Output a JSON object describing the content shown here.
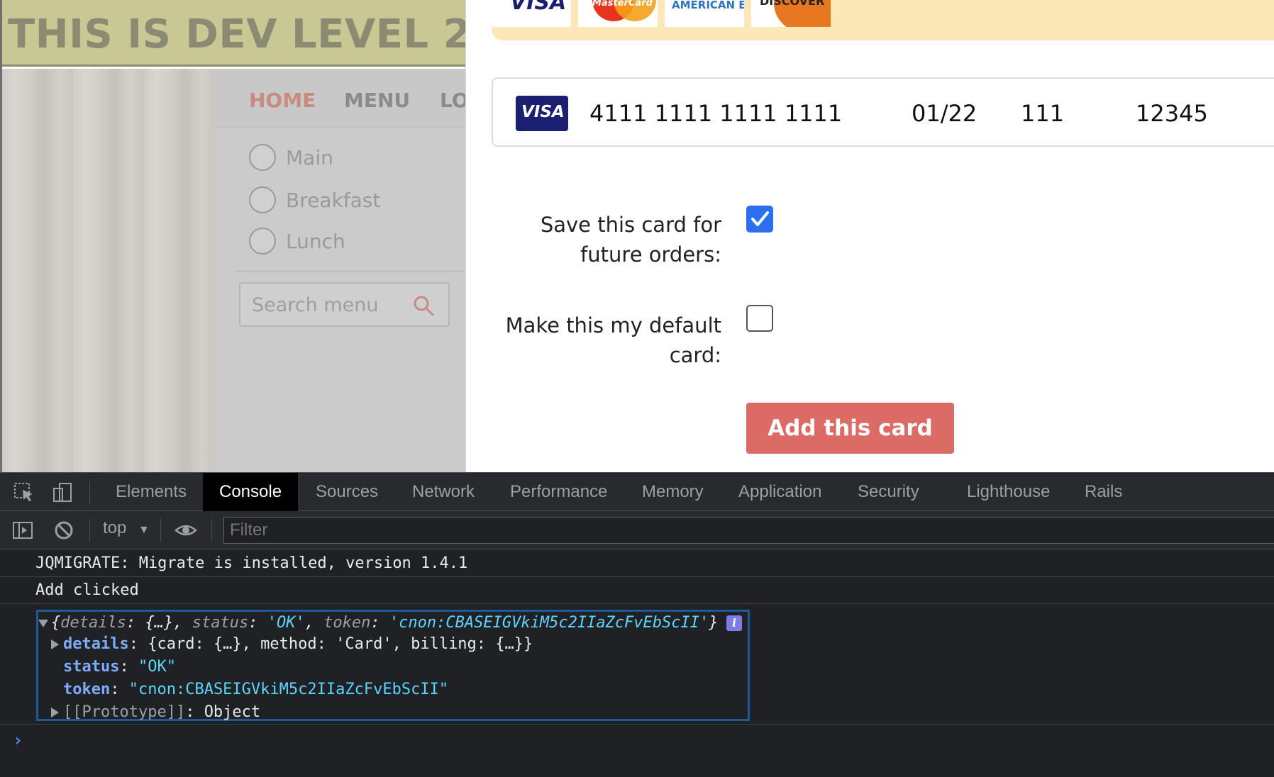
{
  "site": {
    "dev_banner": "THIS IS DEV LEVEL 2",
    "nav": [
      "HOME",
      "MENU",
      "LO"
    ],
    "menu_filters": [
      "Main",
      "Breakfast",
      "Lunch"
    ],
    "search_placeholder": "Search menu",
    "accent_color": "#c98a80"
  },
  "payment": {
    "accepted_cards": {
      "visa": "VISA",
      "mastercard": "MasterCard",
      "amex": "AMERICAN EXPRESS",
      "discover": "DISCOVER"
    },
    "card": {
      "brand": "VISA",
      "number": "4111 1111 1111 1111",
      "expiry": "01/22",
      "cvv": "111",
      "postal": "12345"
    },
    "save_card_label": "Save this card for future orders:",
    "save_card_checked": true,
    "default_card_label": "Make this my default card:",
    "default_card_checked": false,
    "add_button_label": "Add this card",
    "button_color": "#dd6b65"
  },
  "devtools": {
    "tabs": [
      "Elements",
      "Console",
      "Sources",
      "Network",
      "Performance",
      "Memory",
      "Application",
      "Security",
      "Lighthouse",
      "Rails"
    ],
    "active_tab": "Console",
    "context": "top",
    "filter_placeholder": "Filter",
    "console": {
      "lines": [
        "JQMIGRATE: Migrate is installed, version 1.4.1",
        "Add clicked"
      ],
      "object_summary": {
        "open": "{",
        "details_key": "details",
        "details_preview": "{…}",
        "status_key": "status",
        "status_value": "'OK'",
        "token_key": "token",
        "token_value": "'cnon:CBASEIGVkiM5c2IIaZcFvEbScII'",
        "close": "}"
      },
      "details_row": {
        "key": "details",
        "value": "{card: {…}, method: 'Card', billing: {…}}"
      },
      "status_row": {
        "key": "status",
        "value": "\"OK\""
      },
      "token_row": {
        "key": "token",
        "value": "\"cnon:CBASEIGVkiM5c2IIaZcFvEbScII\""
      },
      "prototype_row": {
        "key": "[[Prototype]]",
        "value": "Object"
      },
      "info_badge": "i",
      "prompt": "›"
    }
  }
}
